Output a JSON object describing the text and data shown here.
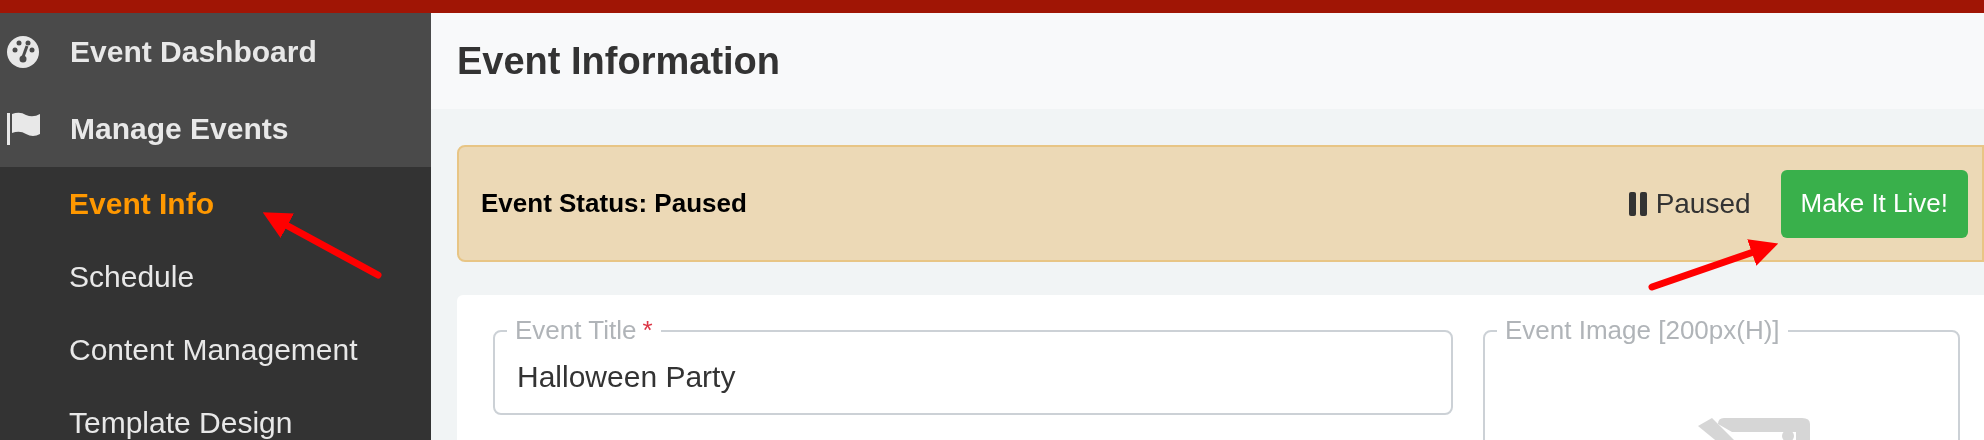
{
  "sidebar": {
    "sections": [
      {
        "label": "Event Dashboard"
      },
      {
        "label": "Manage Events",
        "children": [
          {
            "label": "Event Info",
            "selected": true
          },
          {
            "label": "Schedule",
            "selected": false
          },
          {
            "label": "Content Management",
            "selected": false
          },
          {
            "label": "Template Design",
            "selected": false
          }
        ]
      }
    ]
  },
  "page": {
    "title": "Event Information"
  },
  "status_card": {
    "label": "Event Status: Paused",
    "status": "Paused",
    "paused": true,
    "button": "Make It Live!"
  },
  "form": {
    "fields": [
      {
        "kind": "text",
        "label": "Event Title",
        "required": true,
        "required_mark": "*",
        "value": "Halloween Party"
      },
      {
        "kind": "image",
        "label": "Event Image [200px(H)]",
        "required": false
      }
    ]
  }
}
